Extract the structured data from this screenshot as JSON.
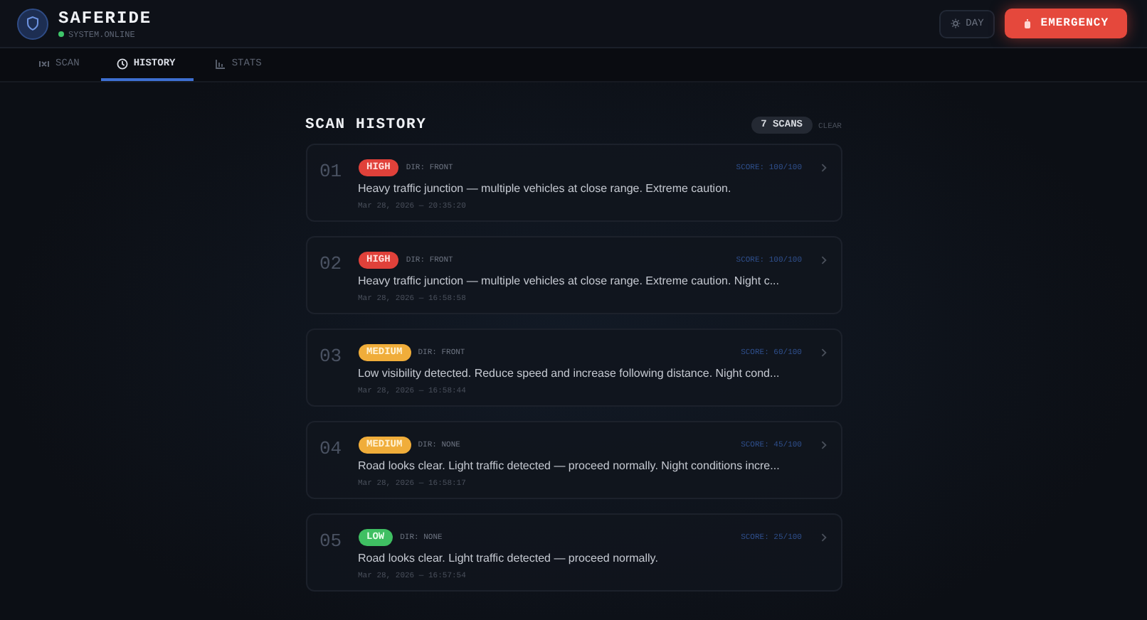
{
  "app": {
    "title": "SAFERIDE",
    "status": "SYSTEM.ONLINE",
    "online": true
  },
  "header_buttons": {
    "theme": "DAY",
    "emergency": "EMERGENCY"
  },
  "tabs": [
    {
      "label": "SCAN",
      "kind": "scan",
      "selected": false
    },
    {
      "label": "HISTORY",
      "kind": "clock",
      "selected": true
    },
    {
      "label": "STATS",
      "kind": "chart",
      "selected": false
    }
  ],
  "history": {
    "title": "SCAN HISTORY",
    "count": "7 SCANS",
    "clear": "CLEAR",
    "scans": [
      {
        "index": "01",
        "kind": "high",
        "badge": "HIGH",
        "direction": "DIR: FRONT",
        "score": "SCORE: 100/100",
        "description": "Heavy traffic junction — multiple vehicles at close range. Extreme caution.",
        "time": "Mar 28, 2026 — 20:35:20"
      },
      {
        "index": "02",
        "kind": "high",
        "badge": "HIGH",
        "direction": "DIR: FRONT",
        "score": "SCORE: 100/100",
        "description": "Heavy traffic junction — multiple vehicles at close range. Extreme caution. Night c...",
        "time": "Mar 28, 2026 — 16:58:58"
      },
      {
        "index": "03",
        "kind": "medium",
        "badge": "MEDIUM",
        "direction": "DIR: FRONT",
        "score": "SCORE: 60/100",
        "description": "Low visibility detected. Reduce speed and increase following distance. Night cond...",
        "time": "Mar 28, 2026 — 16:58:44"
      },
      {
        "index": "04",
        "kind": "medium",
        "badge": "MEDIUM",
        "direction": "DIR: NONE",
        "score": "SCORE: 45/100",
        "description": "Road looks clear. Light traffic detected — proceed normally. Night conditions incre...",
        "time": "Mar 28, 2026 — 16:58:17"
      },
      {
        "index": "05",
        "kind": "low",
        "badge": "LOW",
        "direction": "DIR: NONE",
        "score": "SCORE: 25/100",
        "description": "Road looks clear. Light traffic detected — proceed normally.",
        "time": "Mar 28, 2026 — 16:57:54"
      }
    ]
  }
}
